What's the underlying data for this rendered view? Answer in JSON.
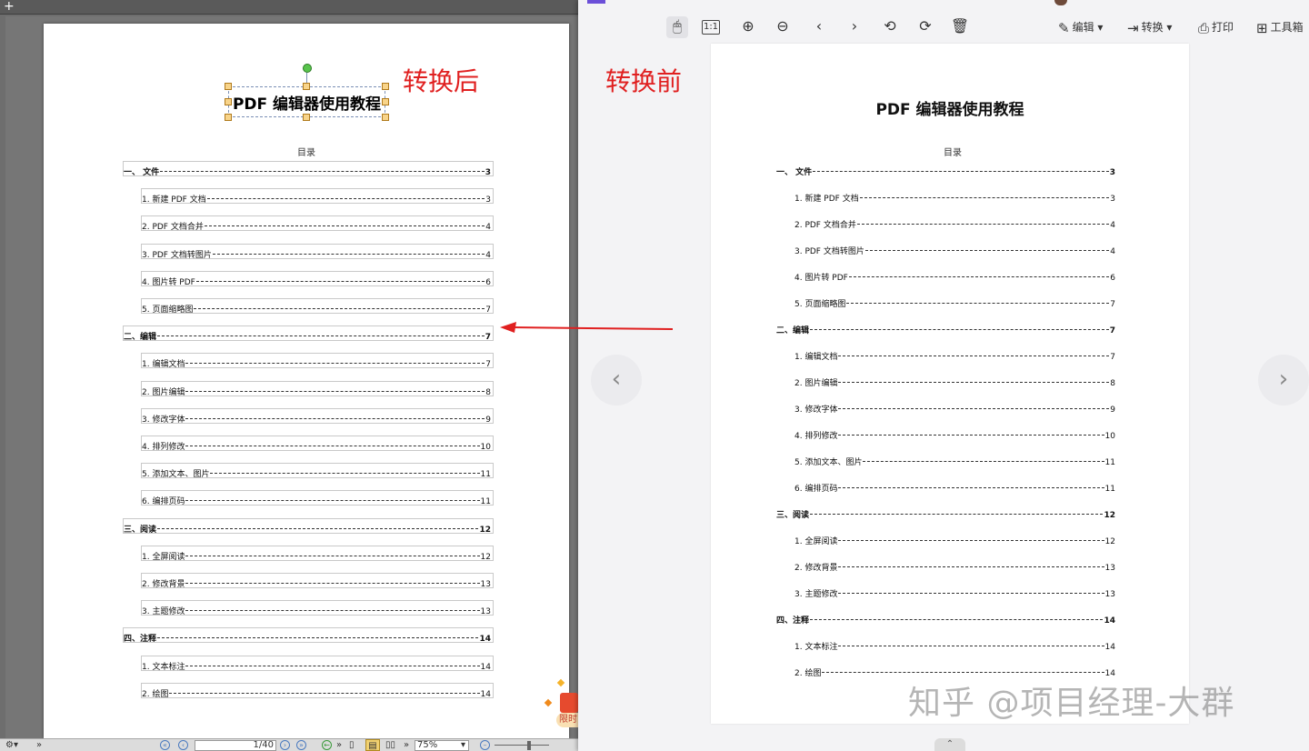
{
  "labels": {
    "after": "转换后",
    "before": "转换前"
  },
  "document": {
    "title": "PDF 编辑器使用教程",
    "toc_heading": "目录"
  },
  "toc_after": [
    {
      "text": "一、  文件",
      "page": "3",
      "bold": true,
      "indent": false
    },
    {
      "text": "1. 新建 PDF 文档",
      "page": "3",
      "bold": false,
      "indent": true
    },
    {
      "text": "2. PDF 文档合并",
      "page": "4",
      "bold": false,
      "indent": true
    },
    {
      "text": "3. PDF 文档转图片",
      "page": "4",
      "bold": false,
      "indent": true
    },
    {
      "text": "4. 图片转 PDF",
      "page": "6",
      "bold": false,
      "indent": true
    },
    {
      "text": "5. 页面缩略图",
      "page": "7",
      "bold": false,
      "indent": true
    },
    {
      "text": "二、编辑",
      "page": "7",
      "bold": true,
      "indent": false
    },
    {
      "text": "1. 编辑文档",
      "page": "7",
      "bold": false,
      "indent": true
    },
    {
      "text": "2. 图片编辑",
      "page": "8",
      "bold": false,
      "indent": true
    },
    {
      "text": "3. 修改字体",
      "page": "9",
      "bold": false,
      "indent": true
    },
    {
      "text": "4. 排列修改",
      "page": "10",
      "bold": false,
      "indent": true
    },
    {
      "text": "5. 添加文本、图片",
      "page": "11",
      "bold": false,
      "indent": true
    },
    {
      "text": "6. 编排页码",
      "page": "11",
      "bold": false,
      "indent": true
    },
    {
      "text": "三、阅读",
      "page": "12",
      "bold": true,
      "indent": false
    },
    {
      "text": "1. 全屏阅读",
      "page": "12",
      "bold": false,
      "indent": true
    },
    {
      "text": "2. 修改背景",
      "page": "13",
      "bold": false,
      "indent": true
    },
    {
      "text": "3. 主题修改",
      "page": "13",
      "bold": false,
      "indent": true
    },
    {
      "text": "四、注释",
      "page": "14",
      "bold": true,
      "indent": false
    },
    {
      "text": "1. 文本标注",
      "page": "14",
      "bold": false,
      "indent": true
    },
    {
      "text": "2. 绘图",
      "page": "14",
      "bold": false,
      "indent": true
    }
  ],
  "toc_before": [
    {
      "text": "一、  文件",
      "page": "3",
      "bold": true,
      "indent": false
    },
    {
      "text": "1. 新建 PDF 文档",
      "page": "3",
      "bold": false,
      "indent": true
    },
    {
      "text": "2. PDF 文档合并",
      "page": "4",
      "bold": false,
      "indent": true
    },
    {
      "text": "3. PDF 文档转图片",
      "page": "4",
      "bold": false,
      "indent": true
    },
    {
      "text": "4. 图片转 PDF",
      "page": "6",
      "bold": false,
      "indent": true
    },
    {
      "text": "5. 页面缩略图",
      "page": "7",
      "bold": false,
      "indent": true
    },
    {
      "text": "二、编辑",
      "page": "7",
      "bold": true,
      "indent": false
    },
    {
      "text": "1. 编辑文档",
      "page": "7",
      "bold": false,
      "indent": true
    },
    {
      "text": "2. 图片编辑",
      "page": "8",
      "bold": false,
      "indent": true
    },
    {
      "text": "3. 修改字体",
      "page": "9",
      "bold": false,
      "indent": true
    },
    {
      "text": "4. 排列修改",
      "page": "10",
      "bold": false,
      "indent": true
    },
    {
      "text": "5. 添加文本、图片",
      "page": "11",
      "bold": false,
      "indent": true
    },
    {
      "text": "6. 编排页码",
      "page": "11",
      "bold": false,
      "indent": true
    },
    {
      "text": "三、阅读",
      "page": "12",
      "bold": true,
      "indent": false
    },
    {
      "text": "1. 全屏阅读",
      "page": "12",
      "bold": false,
      "indent": true
    },
    {
      "text": "2. 修改背景",
      "page": "13",
      "bold": false,
      "indent": true
    },
    {
      "text": "3. 主题修改",
      "page": "13",
      "bold": false,
      "indent": true
    },
    {
      "text": "四、注释",
      "page": "14",
      "bold": true,
      "indent": false
    },
    {
      "text": "1. 文本标注",
      "page": "14",
      "bold": false,
      "indent": true
    },
    {
      "text": "2. 绘图",
      "page": "14",
      "bold": false,
      "indent": true
    }
  ],
  "viewer_toolbar": {
    "zoom_actual": "1:1",
    "edit_label": "编辑",
    "convert_label": "转换",
    "print_label": "打印",
    "tools_label": "工具箱"
  },
  "editor_status": {
    "page_field": "1/40",
    "zoom": "75%"
  },
  "promo_tag": "限时",
  "watermark": "知乎 @项目经理-大群",
  "colors": {
    "accent_red": "#e02020",
    "canvas_gray": "#767676"
  }
}
